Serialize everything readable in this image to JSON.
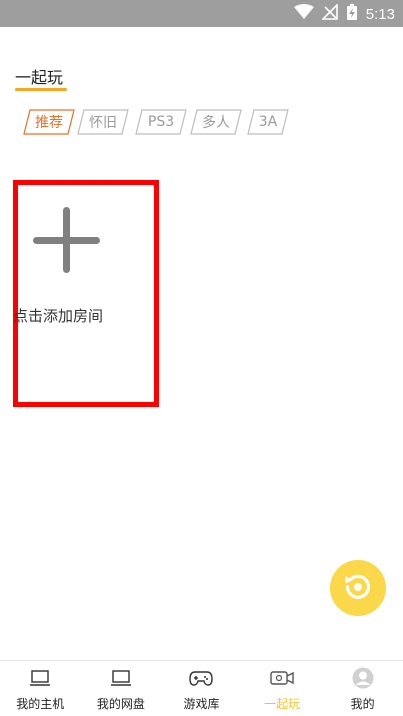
{
  "status_bar": {
    "time": "5:13"
  },
  "page": {
    "title": "一起玩"
  },
  "tags": [
    {
      "label": "推荐",
      "active": true
    },
    {
      "label": "怀旧",
      "active": false
    },
    {
      "label": "PS3",
      "active": false
    },
    {
      "label": "多人",
      "active": false
    },
    {
      "label": "3A",
      "active": false
    }
  ],
  "add_room": {
    "label": "点击添加房间"
  },
  "tab_bar": {
    "items": [
      {
        "label": "我的主机",
        "icon": "laptop-icon",
        "active": false
      },
      {
        "label": "我的网盘",
        "icon": "laptop-icon",
        "active": false
      },
      {
        "label": "游戏库",
        "icon": "gamepad-icon",
        "active": false
      },
      {
        "label": "一起玩",
        "icon": "video-camera-icon",
        "active": true
      },
      {
        "label": "我的",
        "icon": "avatar-icon",
        "active": false
      }
    ]
  },
  "colors": {
    "accent": "#f5a623",
    "tab_active": "#f5c232",
    "tag_active": "#e8702a",
    "fab": "#fad849",
    "highlight_border": "#ff0000"
  }
}
